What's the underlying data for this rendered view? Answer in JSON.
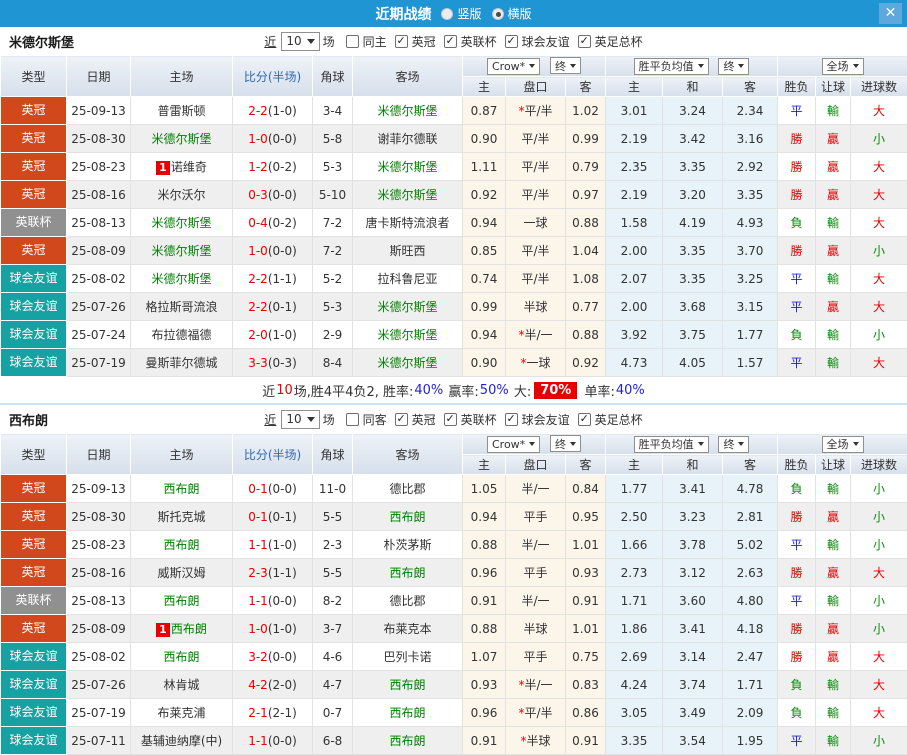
{
  "titlebar": {
    "title": "近期战绩",
    "options": [
      {
        "label": "竖版",
        "selected": false
      },
      {
        "label": "横版",
        "selected": true
      }
    ]
  },
  "icons": {
    "close": "✕",
    "check": "✓"
  },
  "filters": {
    "prefix": "近",
    "count": "10",
    "suffix": "场"
  },
  "table_header": {
    "main": [
      "类型",
      "日期",
      "主场",
      "比分(半场)",
      "角球",
      "客场"
    ],
    "odds_select": "Crow*",
    "final_select": "终",
    "avg_select": "胜平负均值",
    "final_select2": "终",
    "scope_select": "全场",
    "sub": [
      "主",
      "盘口",
      "客",
      "主",
      "和",
      "客",
      "胜负",
      "让球",
      "进球数"
    ]
  },
  "colors": {
    "topbar": "#2095d3",
    "type_badges": {
      "英冠": "#d2481d",
      "英联杯": "#909090",
      "球会友谊": "#16a2a2"
    },
    "result": {
      "勝": "#e60000",
      "贏": "#e60000",
      "大": "#e60000",
      "平": "#1b1bd4",
      "負": "#0a8a0a",
      "輸": "#0a8a0a",
      "小": "#0a8a0a"
    },
    "subject_team": "#008000",
    "fulltime_score": "#e60000"
  },
  "sections": [
    {
      "team": "米德尔斯堡",
      "same_label": "同主",
      "comps": [
        "英冠",
        "英联杯",
        "球会友谊",
        "英足总杯"
      ],
      "rows": [
        {
          "type": "英冠",
          "date": "25-09-13",
          "home": "普雷斯顿",
          "home_subject": false,
          "home_rc": "",
          "ft": "2-2",
          "ht": "(1-0)",
          "corner": "3-4",
          "away": "米德尔斯堡",
          "away_subject": true,
          "away_rc": "",
          "h": "0.87",
          "hcp": "平/半",
          "star": true,
          "a": "1.02",
          "w": "3.01",
          "d": "3.24",
          "l": "2.34",
          "res": [
            "平",
            "輸",
            "大"
          ]
        },
        {
          "type": "英冠",
          "date": "25-08-30",
          "home": "米德尔斯堡",
          "home_subject": true,
          "home_rc": "",
          "ft": "1-0",
          "ht": "(0-0)",
          "corner": "5-8",
          "away": "谢菲尔德联",
          "away_subject": false,
          "away_rc": "",
          "h": "0.90",
          "hcp": "平/半",
          "star": false,
          "a": "0.99",
          "w": "2.19",
          "d": "3.42",
          "l": "3.16",
          "res": [
            "勝",
            "贏",
            "小"
          ]
        },
        {
          "type": "英冠",
          "date": "25-08-23",
          "home": "诺维奇",
          "home_subject": false,
          "home_rc": "1",
          "ft": "1-2",
          "ht": "(0-2)",
          "corner": "5-3",
          "away": "米德尔斯堡",
          "away_subject": true,
          "away_rc": "",
          "h": "1.11",
          "hcp": "平/半",
          "star": false,
          "a": "0.79",
          "w": "2.35",
          "d": "3.35",
          "l": "2.92",
          "res": [
            "勝",
            "贏",
            "大"
          ]
        },
        {
          "type": "英冠",
          "date": "25-08-16",
          "home": "米尔沃尔",
          "home_subject": false,
          "home_rc": "",
          "ft": "0-3",
          "ht": "(0-0)",
          "corner": "5-10",
          "away": "米德尔斯堡",
          "away_subject": true,
          "away_rc": "",
          "h": "0.92",
          "hcp": "平/半",
          "star": false,
          "a": "0.97",
          "w": "2.19",
          "d": "3.20",
          "l": "3.35",
          "res": [
            "勝",
            "贏",
            "大"
          ]
        },
        {
          "type": "英联杯",
          "date": "25-08-13",
          "home": "米德尔斯堡",
          "home_subject": true,
          "home_rc": "",
          "ft": "0-4",
          "ht": "(0-2)",
          "corner": "7-2",
          "away": "唐卡斯特流浪者",
          "away_subject": false,
          "away_rc": "",
          "h": "0.94",
          "hcp": "一球",
          "star": false,
          "a": "0.88",
          "w": "1.58",
          "d": "4.19",
          "l": "4.93",
          "res": [
            "負",
            "輸",
            "大"
          ]
        },
        {
          "type": "英冠",
          "date": "25-08-09",
          "home": "米德尔斯堡",
          "home_subject": true,
          "home_rc": "",
          "ft": "1-0",
          "ht": "(0-0)",
          "corner": "7-2",
          "away": "斯旺西",
          "away_subject": false,
          "away_rc": "",
          "h": "0.85",
          "hcp": "平/半",
          "star": false,
          "a": "1.04",
          "w": "2.00",
          "d": "3.35",
          "l": "3.70",
          "res": [
            "勝",
            "贏",
            "小"
          ]
        },
        {
          "type": "球会友谊",
          "date": "25-08-02",
          "home": "米德尔斯堡",
          "home_subject": true,
          "home_rc": "",
          "ft": "2-2",
          "ht": "(1-1)",
          "corner": "5-2",
          "away": "拉科鲁尼亚",
          "away_subject": false,
          "away_rc": "",
          "h": "0.74",
          "hcp": "平/半",
          "star": false,
          "a": "1.08",
          "w": "2.07",
          "d": "3.35",
          "l": "3.25",
          "res": [
            "平",
            "輸",
            "大"
          ]
        },
        {
          "type": "球会友谊",
          "date": "25-07-26",
          "home": "格拉斯哥流浪",
          "home_subject": false,
          "home_rc": "",
          "ft": "2-2",
          "ht": "(0-1)",
          "corner": "5-3",
          "away": "米德尔斯堡",
          "away_subject": true,
          "away_rc": "",
          "h": "0.99",
          "hcp": "半球",
          "star": false,
          "a": "0.77",
          "w": "2.00",
          "d": "3.68",
          "l": "3.15",
          "res": [
            "平",
            "贏",
            "大"
          ]
        },
        {
          "type": "球会友谊",
          "date": "25-07-24",
          "home": "布拉德福德",
          "home_subject": false,
          "home_rc": "",
          "ft": "2-0",
          "ht": "(1-0)",
          "corner": "2-9",
          "away": "米德尔斯堡",
          "away_subject": true,
          "away_rc": "",
          "h": "0.94",
          "hcp": "半/一",
          "star": true,
          "a": "0.88",
          "w": "3.92",
          "d": "3.75",
          "l": "1.77",
          "res": [
            "負",
            "輸",
            "小"
          ]
        },
        {
          "type": "球会友谊",
          "date": "25-07-19",
          "home": "曼斯菲尔德城",
          "home_subject": false,
          "home_rc": "",
          "ft": "3-3",
          "ht": "(0-3)",
          "corner": "8-4",
          "away": "米德尔斯堡",
          "away_subject": true,
          "away_rc": "",
          "h": "0.90",
          "hcp": "一球",
          "star": true,
          "a": "0.92",
          "w": "4.73",
          "d": "4.05",
          "l": "1.57",
          "res": [
            "平",
            "輸",
            "大"
          ]
        }
      ],
      "summary": [
        {
          "text": "近",
          "style": "dark"
        },
        {
          "text": "10",
          "style": "red"
        },
        {
          "text": "场,胜4平4负2, 胜率:",
          "style": "dark"
        },
        {
          "text": "40%",
          "style": "blue"
        },
        {
          "text": " 赢率:",
          "style": "dark"
        },
        {
          "text": "50%",
          "style": "blue"
        },
        {
          "text": " 大:",
          "style": "dark"
        },
        {
          "text": "70%",
          "style": "hl"
        },
        {
          "text": " 单率:",
          "style": "dark"
        },
        {
          "text": "40%",
          "style": "blue"
        }
      ]
    },
    {
      "team": "西布朗",
      "same_label": "同客",
      "comps": [
        "英冠",
        "英联杯",
        "球会友谊",
        "英足总杯"
      ],
      "rows": [
        {
          "type": "英冠",
          "date": "25-09-13",
          "home": "西布朗",
          "home_subject": true,
          "home_rc": "",
          "ft": "0-1",
          "ht": "(0-0)",
          "corner": "11-0",
          "away": "德比郡",
          "away_subject": false,
          "away_rc": "",
          "h": "1.05",
          "hcp": "半/一",
          "star": false,
          "a": "0.84",
          "w": "1.77",
          "d": "3.41",
          "l": "4.78",
          "res": [
            "負",
            "輸",
            "小"
          ]
        },
        {
          "type": "英冠",
          "date": "25-08-30",
          "home": "斯托克城",
          "home_subject": false,
          "home_rc": "",
          "ft": "0-1",
          "ht": "(0-1)",
          "corner": "5-5",
          "away": "西布朗",
          "away_subject": true,
          "away_rc": "",
          "h": "0.94",
          "hcp": "平手",
          "star": false,
          "a": "0.95",
          "w": "2.50",
          "d": "3.23",
          "l": "2.81",
          "res": [
            "勝",
            "贏",
            "小"
          ]
        },
        {
          "type": "英冠",
          "date": "25-08-23",
          "home": "西布朗",
          "home_subject": true,
          "home_rc": "",
          "ft": "1-1",
          "ht": "(1-0)",
          "corner": "2-3",
          "away": "朴茨茅斯",
          "away_subject": false,
          "away_rc": "",
          "h": "0.88",
          "hcp": "半/一",
          "star": false,
          "a": "1.01",
          "w": "1.66",
          "d": "3.78",
          "l": "5.02",
          "res": [
            "平",
            "輸",
            "小"
          ]
        },
        {
          "type": "英冠",
          "date": "25-08-16",
          "home": "威斯汉姆",
          "home_subject": false,
          "home_rc": "",
          "ft": "2-3",
          "ht": "(1-1)",
          "corner": "5-5",
          "away": "西布朗",
          "away_subject": true,
          "away_rc": "",
          "h": "0.96",
          "hcp": "平手",
          "star": false,
          "a": "0.93",
          "w": "2.73",
          "d": "3.12",
          "l": "2.63",
          "res": [
            "勝",
            "贏",
            "大"
          ]
        },
        {
          "type": "英联杯",
          "date": "25-08-13",
          "home": "西布朗",
          "home_subject": true,
          "home_rc": "",
          "ft": "1-1",
          "ht": "(0-0)",
          "corner": "8-2",
          "away": "德比郡",
          "away_subject": false,
          "away_rc": "",
          "h": "0.91",
          "hcp": "半/一",
          "star": false,
          "a": "0.91",
          "w": "1.71",
          "d": "3.60",
          "l": "4.80",
          "res": [
            "平",
            "輸",
            "小"
          ]
        },
        {
          "type": "英冠",
          "date": "25-08-09",
          "home": "西布朗",
          "home_subject": true,
          "home_rc": "1",
          "ft": "1-0",
          "ht": "(1-0)",
          "corner": "3-7",
          "away": "布莱克本",
          "away_subject": false,
          "away_rc": "",
          "h": "0.88",
          "hcp": "半球",
          "star": false,
          "a": "1.01",
          "w": "1.86",
          "d": "3.41",
          "l": "4.18",
          "res": [
            "勝",
            "贏",
            "小"
          ]
        },
        {
          "type": "球会友谊",
          "date": "25-08-02",
          "home": "西布朗",
          "home_subject": true,
          "home_rc": "",
          "ft": "3-2",
          "ht": "(0-0)",
          "corner": "4-6",
          "away": "巴列卡诺",
          "away_subject": false,
          "away_rc": "",
          "h": "1.07",
          "hcp": "平手",
          "star": false,
          "a": "0.75",
          "w": "2.69",
          "d": "3.14",
          "l": "2.47",
          "res": [
            "勝",
            "贏",
            "大"
          ]
        },
        {
          "type": "球会友谊",
          "date": "25-07-26",
          "home": "林肯城",
          "home_subject": false,
          "home_rc": "",
          "ft": "4-2",
          "ht": "(2-0)",
          "corner": "4-7",
          "away": "西布朗",
          "away_subject": true,
          "away_rc": "",
          "h": "0.93",
          "hcp": "半/一",
          "star": true,
          "a": "0.83",
          "w": "4.24",
          "d": "3.74",
          "l": "1.71",
          "res": [
            "負",
            "輸",
            "大"
          ]
        },
        {
          "type": "球会友谊",
          "date": "25-07-19",
          "home": "布莱克浦",
          "home_subject": false,
          "home_rc": "",
          "ft": "2-1",
          "ht": "(2-1)",
          "corner": "0-7",
          "away": "西布朗",
          "away_subject": true,
          "away_rc": "",
          "h": "0.96",
          "hcp": "平/半",
          "star": true,
          "a": "0.86",
          "w": "3.05",
          "d": "3.49",
          "l": "2.09",
          "res": [
            "負",
            "輸",
            "大"
          ]
        },
        {
          "type": "球会友谊",
          "date": "25-07-11",
          "home": "基辅迪纳摩(中)",
          "home_subject": false,
          "home_rc": "",
          "ft": "1-1",
          "ht": "(0-0)",
          "corner": "6-8",
          "away": "西布朗",
          "away_subject": true,
          "away_rc": "",
          "h": "0.91",
          "hcp": "半球",
          "star": true,
          "a": "0.91",
          "w": "3.35",
          "d": "3.54",
          "l": "1.95",
          "res": [
            "平",
            "輸",
            "小"
          ]
        }
      ],
      "summary": null
    }
  ]
}
